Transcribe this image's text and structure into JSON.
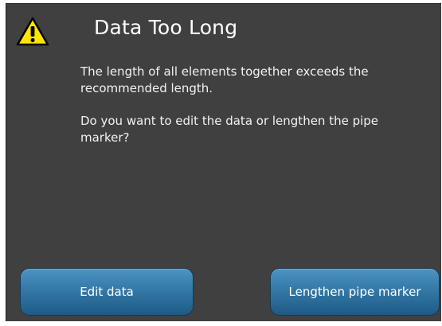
{
  "dialog": {
    "title": "Data Too Long",
    "icon": "warning-icon",
    "message_1": "The length of all elements together exceeds the recommended length.",
    "message_2": "Do you want to edit the data or lengthen the pipe marker?"
  },
  "buttons": {
    "edit_label": "Edit data",
    "lengthen_label": "Lengthen pipe marker"
  },
  "colors": {
    "background": "#404040",
    "button": "#3479a8",
    "warning": "#ffe600"
  }
}
